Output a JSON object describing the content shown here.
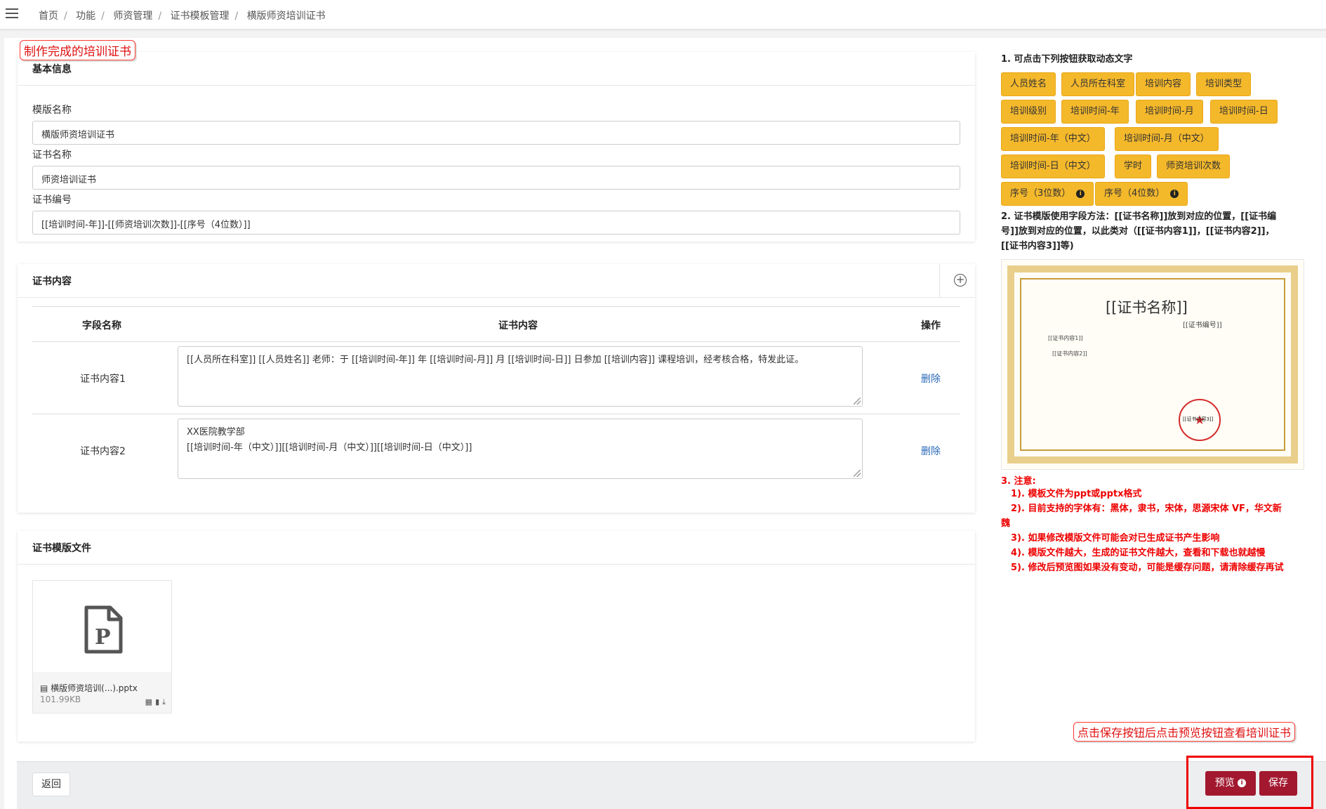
{
  "breadcrumb": [
    "首页",
    "功能",
    "师资管理",
    "证书模板管理",
    "横版师资培训证书"
  ],
  "callouts": {
    "top": "制作完成的培训证书",
    "bottom": "点击保存按钮后点击预览按钮查看培训证书"
  },
  "basic_info": {
    "title": "基本信息",
    "template_name_label": "模版名称",
    "template_name_value": "横版师资培训证书",
    "cert_name_label": "证书名称",
    "cert_name_value": "师资培训证书",
    "cert_no_label": "证书编号",
    "cert_no_value": "[[培训时间-年]]-[[师资培训次数]]-[[序号（4位数）]]"
  },
  "cert_content": {
    "title": "证书内容",
    "columns": [
      "字段名称",
      "证书内容",
      "操作"
    ],
    "rows": [
      {
        "name": "证书内容1",
        "content": "[[人员所在科室]] [[人员姓名]] 老师：于 [[培训时间-年]] 年 [[培训时间-月]] 月 [[培训时间-日]] 日参加 [[培训内容]] 课程培训，经考核合格，特发此证。",
        "action": "删除"
      },
      {
        "name": "证书内容2",
        "content": "XX医院教学部\n[[培训时间-年（中文）]][[培训时间-月（中文）]][[培训时间-日（中文）]]",
        "action": "删除"
      }
    ]
  },
  "template_file": {
    "title": "证书模版文件",
    "file_name": "横版师资培训(...).pptx",
    "file_size": "101.99KB"
  },
  "footer": {
    "back": "返回",
    "preview": "预览",
    "save": "保存"
  },
  "right_panel": {
    "step1": "1. 可点击下列按钮获取动态文字",
    "chips": [
      "人员姓名",
      "人员所在科室",
      "培训内容",
      "培训类型",
      "培训级别",
      "培训时间-年",
      "培训时间-月",
      "培训时间-日",
      "培训时间-年（中文）",
      "培训时间-月（中文）",
      "培训时间-日（中文）",
      "学时",
      "师资培训次数",
      "序号（3位数）",
      "序号（4位数）"
    ],
    "step2_line1": "2. 证书模版使用字段方法：[[证书名称]]放到对应的位置，[[证书编",
    "step2_line2": "号]]放到对应的位置，以此类对（[[证书内容1]]，[[证书内容2]]，",
    "step2_line3": "[[证书内容3]]等)",
    "cert_preview": {
      "name": "[[证书名称]]",
      "no": "[[证书编号]]",
      "c1": "[[证书内容1]]",
      "c2": "[[证书内容2]]",
      "seal": "[[证书内容3]]"
    },
    "step3": "3. 注意:",
    "notes": [
      "1). 模板文件为ppt或pptx格式",
      "2). 目前支持的字体有：黑体，隶书，宋体，思源宋体 VF，华文新",
      "魏",
      "3). 如果修改模版文件可能会对已生成证书产生影响",
      "4). 模版文件越大，生成的证书文件越大，查看和下载也就越慢",
      "5). 修改后预览图如果没有变动，可能是缓存问题，请清除缓存再试"
    ]
  }
}
